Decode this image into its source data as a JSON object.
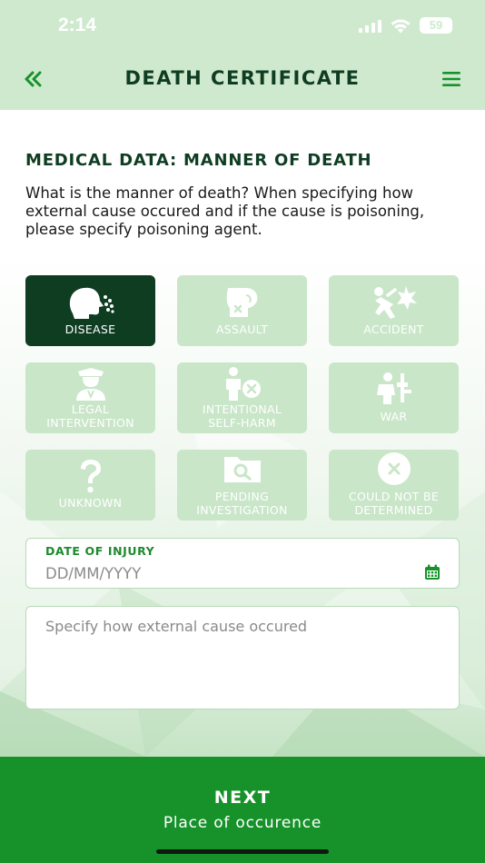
{
  "status": {
    "time": "2:14",
    "battery": "59",
    "icons": [
      "signal-icon",
      "wifi-icon",
      "battery-icon"
    ]
  },
  "nav": {
    "title": "DEATH CERTIFICATE",
    "back_icon": "double-chevron-left-icon",
    "menu_icon": "hamburger-menu-icon"
  },
  "form": {
    "section_title": "MEDICAL DATA: MANNER OF DEATH",
    "question": "What is the manner of death? When specifying how external cause occured and if the cause is poisoning, please specify poisoning agent.",
    "options": [
      {
        "label": "DISEASE",
        "icon": "coughing-head-icon",
        "selected": true
      },
      {
        "label": "ASSAULT",
        "icon": "boxing-glove-icon",
        "selected": false
      },
      {
        "label": "ACCIDENT",
        "icon": "falling-person-icon",
        "selected": false
      },
      {
        "label": "LEGAL INTERVENTION",
        "icon": "police-officer-icon",
        "selected": false
      },
      {
        "label": "INTENTIONAL SELF-HARM",
        "icon": "person-x-icon",
        "selected": false
      },
      {
        "label": "WAR",
        "icon": "soldier-icon",
        "selected": false
      },
      {
        "label": "UNKNOWN",
        "icon": "question-mark-icon",
        "selected": false
      },
      {
        "label": "PENDING INVESTIGATION",
        "icon": "folder-search-icon",
        "selected": false
      },
      {
        "label": "COULD NOT BE DETERMINED",
        "icon": "circle-x-icon",
        "selected": false
      }
    ],
    "date_field": {
      "label": "DATE OF INJURY",
      "placeholder": "DD/MM/YYYY",
      "icon": "calendar-icon"
    },
    "cause_field": {
      "placeholder": "Specify how external cause occured"
    }
  },
  "footer": {
    "next_title": "NEXT",
    "next_subtitle": "Place of occurence"
  },
  "colors": {
    "header_bg": "#cfe9cf",
    "dark_green": "#0f3d22",
    "accent_green": "#17922a",
    "tile_bg": "#c9e6c9"
  }
}
